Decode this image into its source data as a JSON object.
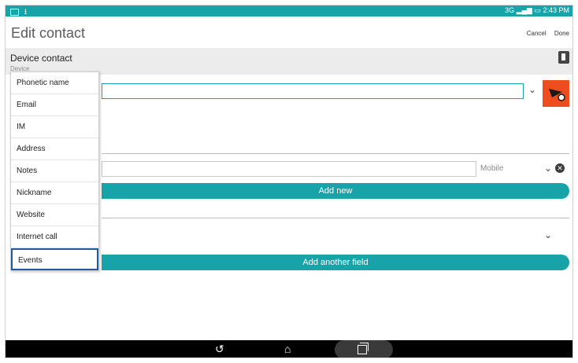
{
  "status_bar": {
    "network": "3G",
    "time": "2:43 PM"
  },
  "header": {
    "title": "Edit contact",
    "cancel_label": "Cancel",
    "done_label": "Done"
  },
  "account": {
    "title": "Device contact",
    "subtitle": "Device"
  },
  "phone": {
    "type_label": "Mobile",
    "add_new_label": "Add new"
  },
  "add_another_field_label": "Add another field",
  "menu": {
    "items": [
      "Phonetic name",
      "Email",
      "IM",
      "Address",
      "Notes",
      "Nickname",
      "Website",
      "Internet call",
      "Events"
    ],
    "selected": "Events"
  },
  "colors": {
    "accent": "#18a3a8",
    "photo": "#ee4d20",
    "selection_border": "#1f5aa0"
  },
  "icons": [
    "phone-icon",
    "chevron-down-icon",
    "clear-icon",
    "back-icon",
    "home-icon",
    "recent-apps-icon"
  ]
}
